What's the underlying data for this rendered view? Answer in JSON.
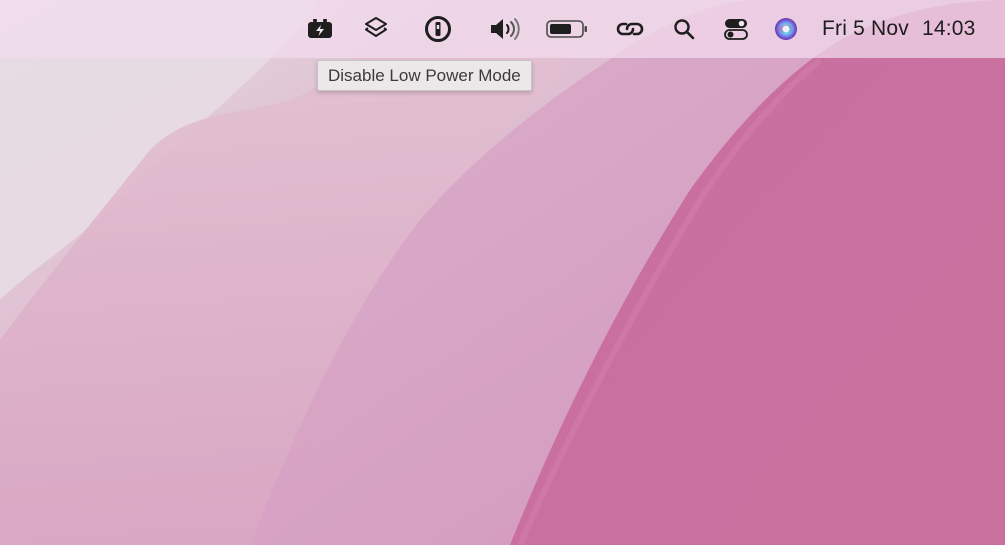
{
  "menubar": {
    "status_icons": [
      {
        "name": "low-power-battery-icon"
      },
      {
        "name": "layers-icon"
      },
      {
        "name": "password-manager-icon"
      },
      {
        "name": "volume-icon"
      },
      {
        "name": "battery-icon"
      },
      {
        "name": "link-icon"
      },
      {
        "name": "spotlight-search-icon"
      },
      {
        "name": "control-center-icon"
      },
      {
        "name": "siri-icon"
      }
    ],
    "date": "Fri 5 Nov",
    "time": "14:03"
  },
  "tooltip": {
    "text": "Disable Low Power Mode"
  },
  "colors": {
    "menubar_text": "#1e1e1e",
    "wallpaper_pink": "#c96f9f",
    "wallpaper_light": "#e6d4df"
  }
}
